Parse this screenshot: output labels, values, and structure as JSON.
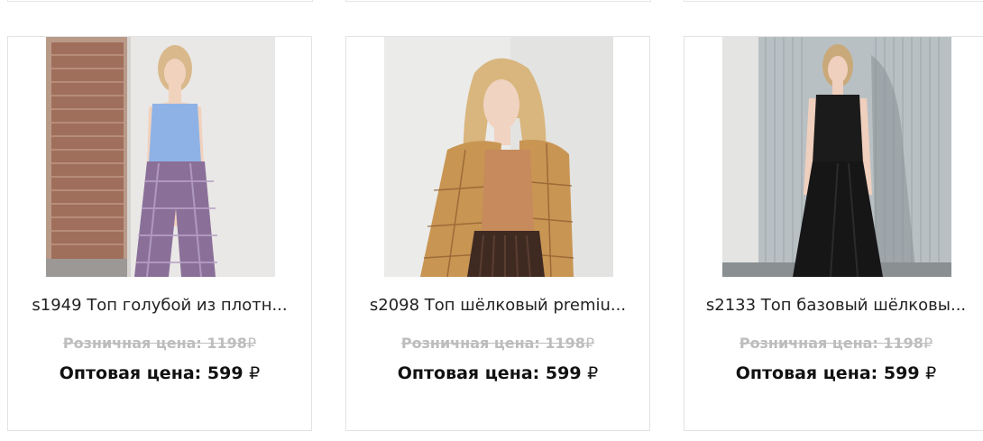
{
  "products": [
    {
      "title": "s1949 Топ голубой из плотн...",
      "retail_label": "Розничная цена:",
      "retail_price": "1198",
      "wholesale_label": "Оптовая цена:",
      "wholesale_price": "599",
      "currency": "₽",
      "top_color": "#8fb2e6",
      "bottom_color": "#8a7099"
    },
    {
      "title": "s2098 Топ шёлковый premiu...",
      "retail_label": "Розничная цена:",
      "retail_price": "1198",
      "wholesale_label": "Оптовая цена:",
      "wholesale_price": "599",
      "currency": "₽",
      "top_color": "#c68a5c",
      "bottom_color": "#3f2a22"
    },
    {
      "title": "s2133 Топ базовый шёлковы...",
      "retail_label": "Розничная цена:",
      "retail_price": "1198",
      "wholesale_label": "Оптовая цена:",
      "wholesale_price": "599",
      "currency": "₽",
      "top_color": "#1b1b1b",
      "bottom_color": "#161616"
    }
  ]
}
